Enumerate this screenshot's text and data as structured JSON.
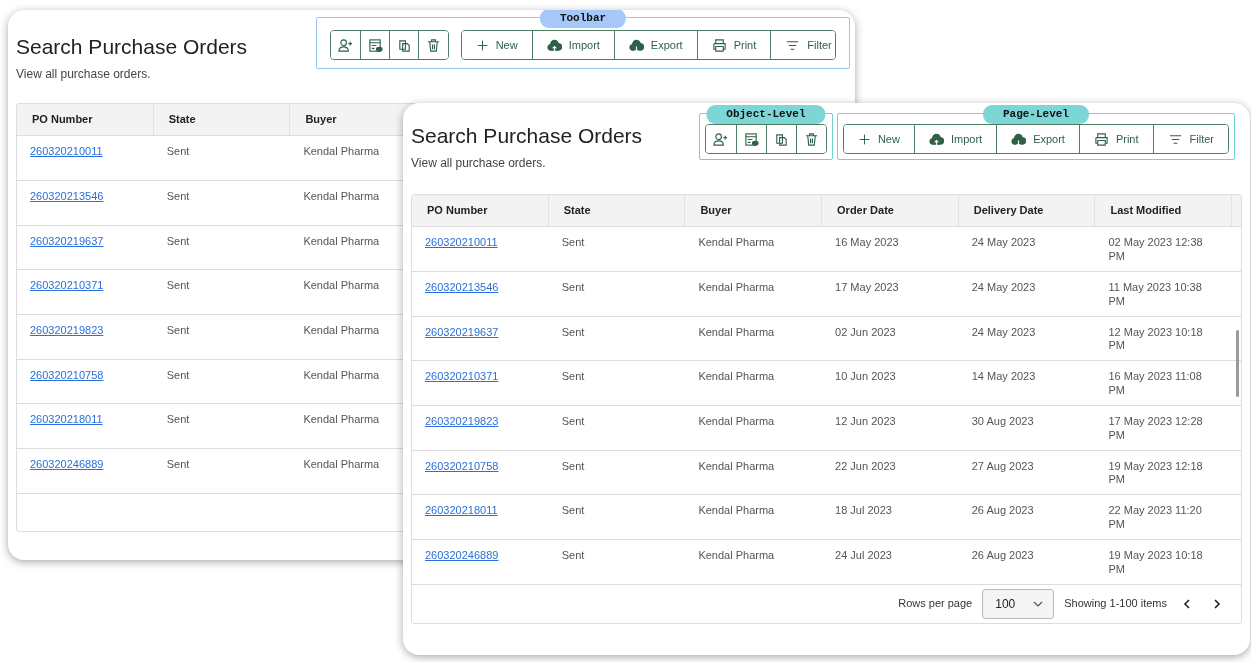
{
  "back_window": {
    "title": "Search Purchase Orders",
    "subtitle": "View all purchase orders.",
    "toolbar_label": "Toolbar",
    "page_actions": [
      {
        "label": "New"
      },
      {
        "label": "Import"
      },
      {
        "label": "Export"
      },
      {
        "label": "Print"
      },
      {
        "label": "Filter"
      }
    ],
    "table": {
      "columns": [
        "PO Number",
        "State",
        "Buyer"
      ],
      "rows": [
        [
          "260320210011",
          "Sent",
          "Kendal Pharma"
        ],
        [
          "260320213546",
          "Sent",
          "Kendal Pharma"
        ],
        [
          "260320219637",
          "Sent",
          "Kendal Pharma"
        ],
        [
          "260320210371",
          "Sent",
          "Kendal Pharma"
        ],
        [
          "260320219823",
          "Sent",
          "Kendal Pharma"
        ],
        [
          "260320210758",
          "Sent",
          "Kendal Pharma"
        ],
        [
          "260320218011",
          "Sent",
          "Kendal Pharma"
        ],
        [
          "260320246889",
          "Sent",
          "Kendal Pharma"
        ]
      ]
    }
  },
  "front_window": {
    "title": "Search Purchase Orders",
    "subtitle": "View all purchase orders.",
    "object_level_label": "Object-Level",
    "page_level_label": "Page-Level",
    "page_actions": [
      {
        "label": "New"
      },
      {
        "label": "Import"
      },
      {
        "label": "Export"
      },
      {
        "label": "Print"
      },
      {
        "label": "Filter"
      }
    ],
    "table": {
      "columns": [
        "PO Number",
        "State",
        "Buyer",
        "Order Date",
        "Delivery Date",
        "Last Modified"
      ],
      "rows": [
        [
          "260320210011",
          "Sent",
          "Kendal Pharma",
          "16 May 2023",
          "24 May 2023",
          "02 May 2023 12:38 PM"
        ],
        [
          "260320213546",
          "Sent",
          "Kendal Pharma",
          "17 May 2023",
          "24 May 2023",
          "11 May 2023 10:38 PM"
        ],
        [
          "260320219637",
          "Sent",
          "Kendal Pharma",
          "02 Jun 2023",
          "24 May 2023",
          "12 May 2023 10:18 PM"
        ],
        [
          "260320210371",
          "Sent",
          "Kendal Pharma",
          "10 Jun 2023",
          "14 May 2023",
          "16 May 2023 11:08 PM"
        ],
        [
          "260320219823",
          "Sent",
          "Kendal Pharma",
          "12 Jun 2023",
          "30 Aug 2023",
          "17 May 2023 12:28 PM"
        ],
        [
          "260320210758",
          "Sent",
          "Kendal Pharma",
          "22 Jun 2023",
          "27 Aug 2023",
          "19 May 2023 12:18 PM"
        ],
        [
          "260320218011",
          "Sent",
          "Kendal Pharma",
          "18 Jul 2023",
          "26 Aug 2023",
          "22 May 2023 11:20 PM"
        ],
        [
          "260320246889",
          "Sent",
          "Kendal Pharma",
          "24 Jul 2023",
          "26 Aug 2023",
          "19 May 2023 10:18 PM"
        ]
      ]
    },
    "footer": {
      "rows_per_page_label": "Rows per page",
      "page_size": "100",
      "showing": "Showing 1-100 items"
    }
  }
}
